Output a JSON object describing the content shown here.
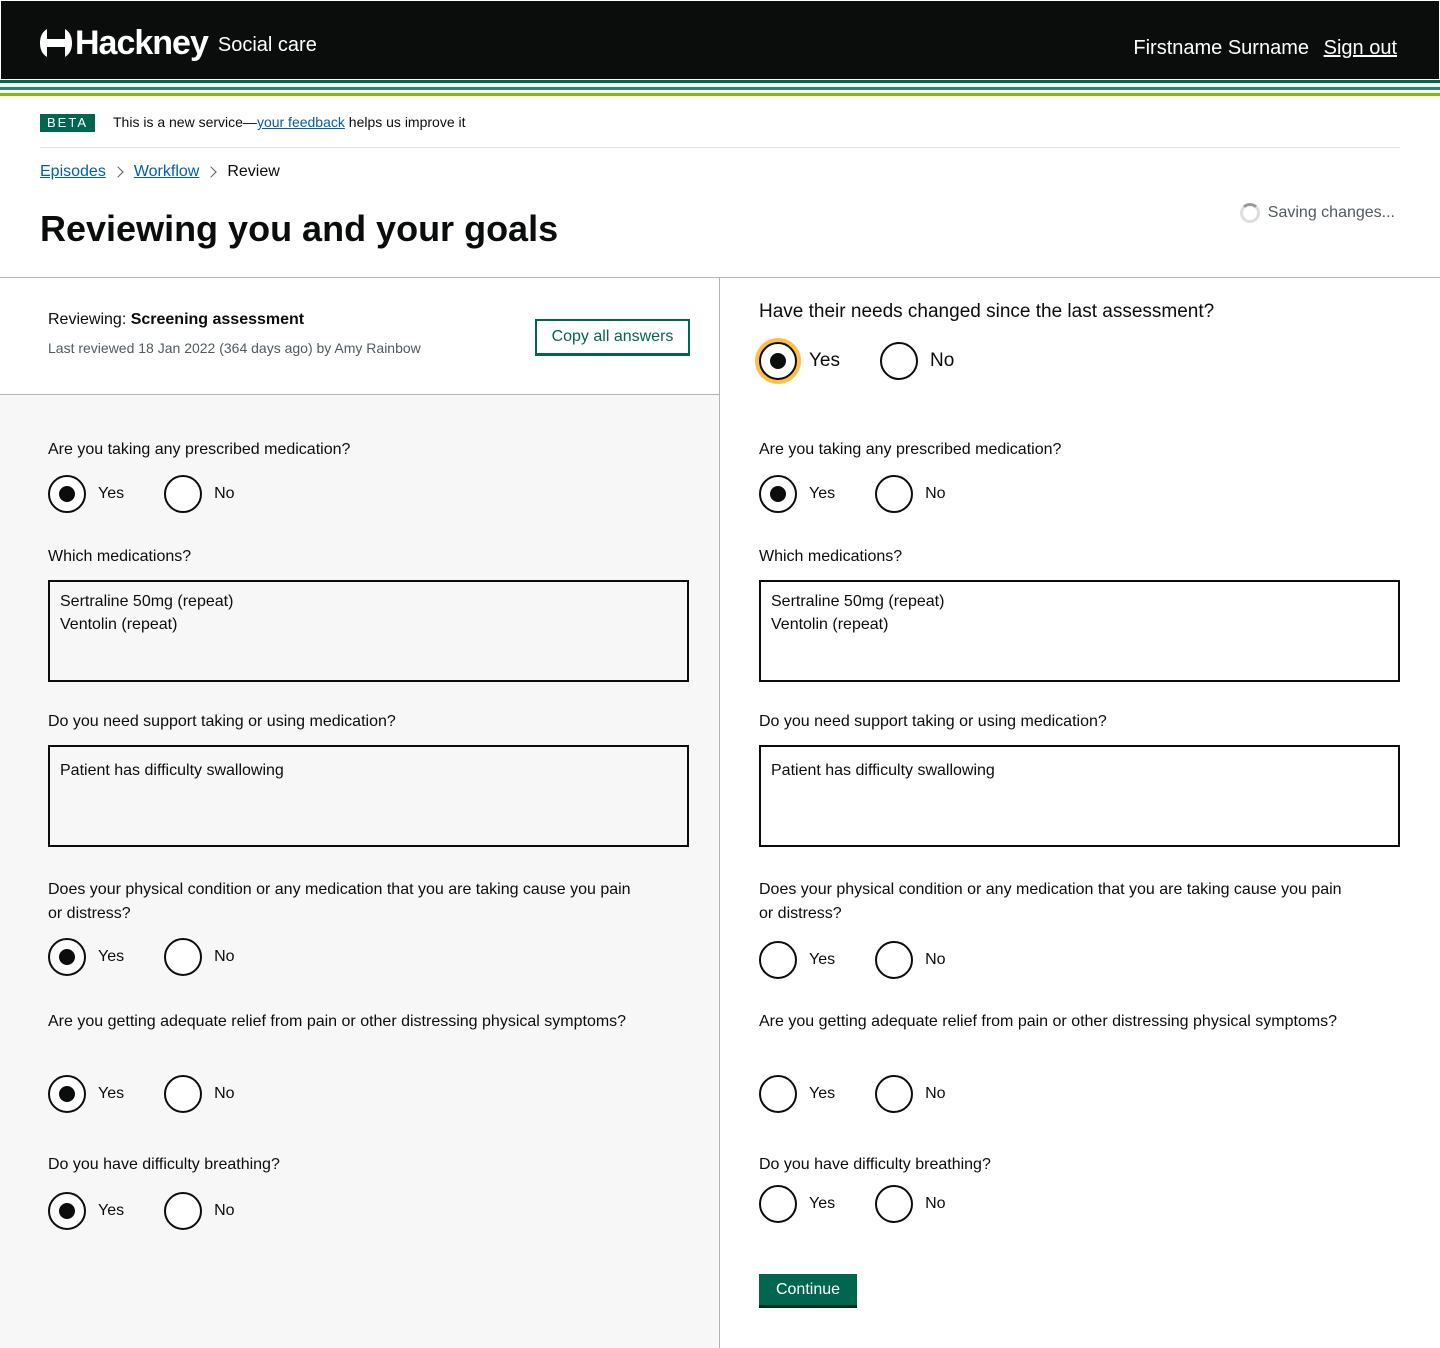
{
  "header": {
    "logo_text": "Hackney",
    "service_name": "Social care",
    "user_name": "Firstname Surname",
    "sign_out": "Sign out"
  },
  "colors": {
    "header_bg": "#0b0c0c",
    "accent_green": "#00664f",
    "link": "#025ea6",
    "focus": "#ffbf47",
    "stripes": [
      "#00664f",
      "#ffffff",
      "#84bd00",
      "#ffffff",
      "#328472"
    ]
  },
  "phase_banner": {
    "tag": "BETA",
    "text_before": "This is a new service—",
    "link_text": "your feedback",
    "text_after": " helps us improve it"
  },
  "breadcrumbs": {
    "items": [
      "Episodes",
      "Workflow"
    ],
    "current": "Review"
  },
  "page": {
    "title": "Reviewing you and your goals",
    "saving_status": "Saving changes..."
  },
  "review": {
    "prefix": "Reviewing: ",
    "name": "Screening assessment",
    "last_reviewed": "Last reviewed 18 Jan 2022 (364 days ago) by Amy Rainbow",
    "copy_button": "Copy all answers"
  },
  "options": {
    "yes": "Yes",
    "no": "No"
  },
  "needs_changed": {
    "question": "Have their needs changed since the last assessment?",
    "selected": "Yes"
  },
  "questions": {
    "medication": "Are you taking any prescribed medication?",
    "which_medications": "Which medications?",
    "support_medication": "Do you need support taking or using medication?",
    "pain": "Does your physical condition or any medication that you are taking cause you pain or distress?",
    "relief": "Are you getting adequate relief from pain or other distressing physical symptoms?",
    "breathing": "Do you have difficulty breathing?"
  },
  "previous_answers": {
    "medication": "Yes",
    "which_medications": "Sertraline 50mg (repeat)\nVentolin (repeat)",
    "support_medication": "Patient has difficulty swallowing",
    "pain": "Yes",
    "relief": "Yes",
    "breathing": "Yes"
  },
  "current_answers": {
    "medication": "Yes",
    "which_medications": "Sertraline 50mg (repeat)\nVentolin (repeat)",
    "support_medication": "Patient has difficulty swallowing",
    "pain": "",
    "relief": "",
    "breathing": ""
  },
  "continue_button": "Continue"
}
